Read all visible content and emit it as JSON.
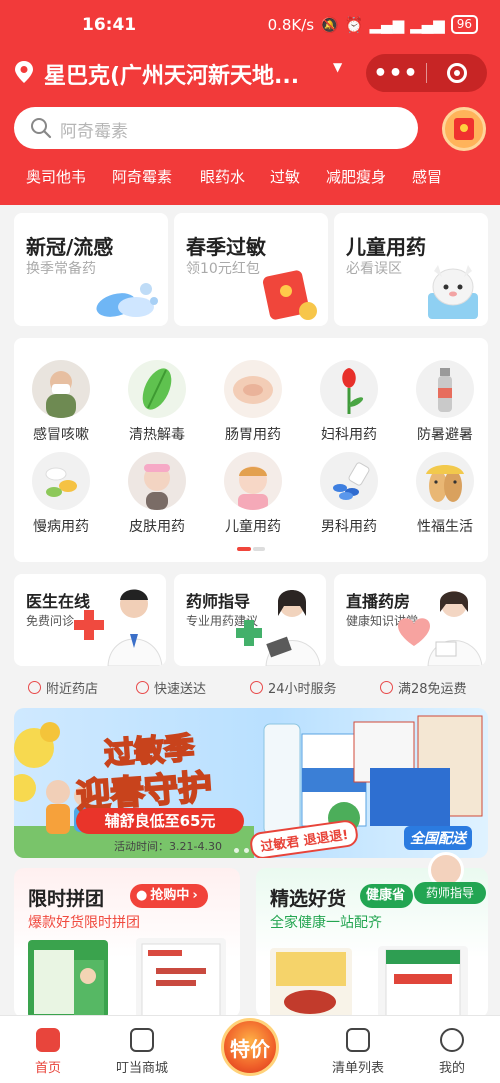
{
  "status_bar": {
    "time": "16:41",
    "right": "0.8K/s",
    "battery": "96"
  },
  "location": {
    "text": "星巴克(广州天河新天地...",
    "caret": "▼"
  },
  "capsule": {
    "more": "•••"
  },
  "search": {
    "placeholder": "阿奇霉素"
  },
  "hot_words": [
    "奥司他韦",
    "阿奇霉素",
    "眼药水",
    "过敏",
    "减肥瘦身",
    "感冒"
  ],
  "feature_cards": [
    {
      "title": "新冠/流感",
      "subtitle": "换季常备药"
    },
    {
      "title": "春季过敏",
      "subtitle": "领10元红包"
    },
    {
      "title": "儿童用药",
      "subtitle": "必看误区"
    }
  ],
  "categories": [
    "感冒咳嗽",
    "清热解毒",
    "肠胃用药",
    "妇科用药",
    "防暑避暑",
    "慢病用药",
    "皮肤用药",
    "儿童用药",
    "男科用药",
    "性福生活"
  ],
  "services": [
    {
      "title": "医生在线",
      "subtitle": "免费问诊"
    },
    {
      "title": "药师指导",
      "subtitle": "专业用药建议"
    },
    {
      "title": "直播药房",
      "subtitle": "健康知识讲堂"
    }
  ],
  "badges": [
    "附近药店",
    "快速送达",
    "24小时服务",
    "满28免运费"
  ],
  "banner": {
    "line1": "过敏季",
    "line2": "迎春守护",
    "promo": "辅舒良低至65元",
    "date": "活动时间：3.21-4.30",
    "slogan": "过敏君 退退退!",
    "national": "全国配送"
  },
  "group_buy": {
    "title": "限时拼团",
    "tag": "抢购中",
    "subtitle": "爆款好货限时拼团"
  },
  "good_picks": {
    "title": "精选好货",
    "tag": "健康省",
    "subtitle": "全家健康一站配齐",
    "pharmacist": "药师指导"
  },
  "tabs": [
    {
      "label": "首页",
      "active": true
    },
    {
      "label": "叮当商城"
    },
    {
      "label": "特价"
    },
    {
      "label": "清单列表"
    },
    {
      "label": "我的"
    }
  ],
  "colors": {
    "brand_red": "#f23a3a",
    "green": "#22a552"
  }
}
